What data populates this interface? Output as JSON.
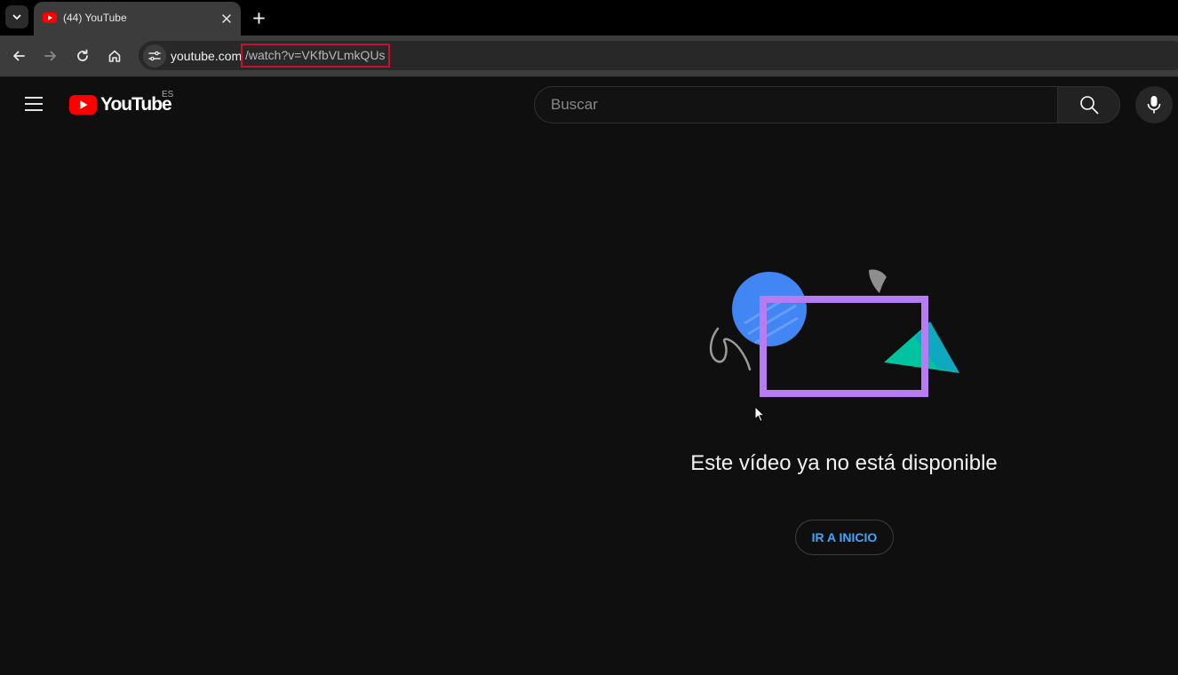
{
  "browser": {
    "tab": {
      "title": "(44) YouTube"
    },
    "address": {
      "host": "youtube.com",
      "path": "/watch?v=VKfbVLmkQUs"
    },
    "icons": {
      "tab_search": "chevron-down-icon",
      "tab_close": "close-icon",
      "new_tab": "plus-icon",
      "back": "back-arrow-icon",
      "forward": "forward-arrow-icon",
      "reload": "reload-icon",
      "home": "home-icon",
      "site_info": "tune-icon"
    },
    "colors": {
      "highlight_border": "#c8102e"
    }
  },
  "masthead": {
    "logo_text": "YouTube",
    "country_code": "ES",
    "search_placeholder": "Buscar",
    "icons": {
      "menu": "hamburger-icon",
      "search": "search-icon",
      "mic": "microphone-icon"
    },
    "colors": {
      "logo_red": "#ff0000"
    }
  },
  "error": {
    "message": "Este vídeo ya no está disponible",
    "home_button_label": "IR A INICIO",
    "colors": {
      "button_text": "#3ea6ff",
      "frame": "#b77cf2",
      "circle": "#4285f4",
      "triangle": "#00c4a0"
    }
  }
}
